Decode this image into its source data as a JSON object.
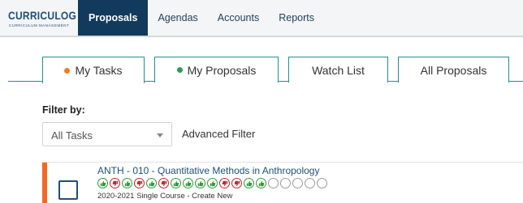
{
  "logo": {
    "name": "CURRICULOG",
    "tagline": "CURRICULUM MANAGEMENT"
  },
  "nav": {
    "items": [
      {
        "label": "Proposals",
        "active": true
      },
      {
        "label": "Agendas",
        "active": false
      },
      {
        "label": "Accounts",
        "active": false
      },
      {
        "label": "Reports",
        "active": false
      }
    ]
  },
  "tabs": [
    {
      "label": "My Tasks",
      "active": true,
      "dot_color": "#f07a1f"
    },
    {
      "label": "My Proposals",
      "active": false,
      "dot_color": "#2e9b57"
    },
    {
      "label": "Watch List",
      "active": false
    },
    {
      "label": "All Proposals",
      "active": false
    }
  ],
  "filter": {
    "label": "Filter by:",
    "selected": "All Tasks",
    "advanced_label": "Advanced Filter"
  },
  "task": {
    "title": "ANTH - 010 - Quantitative Methods in Anthropology",
    "meta": "2020-2021 Single Course - Create New",
    "accent_color": "#f06a24",
    "steps": [
      "up",
      "down",
      "up",
      "down",
      "up",
      "down",
      "up",
      "up",
      "up",
      "up",
      "down",
      "down",
      "up",
      "up",
      "empty",
      "empty",
      "empty",
      "empty",
      "empty"
    ]
  }
}
